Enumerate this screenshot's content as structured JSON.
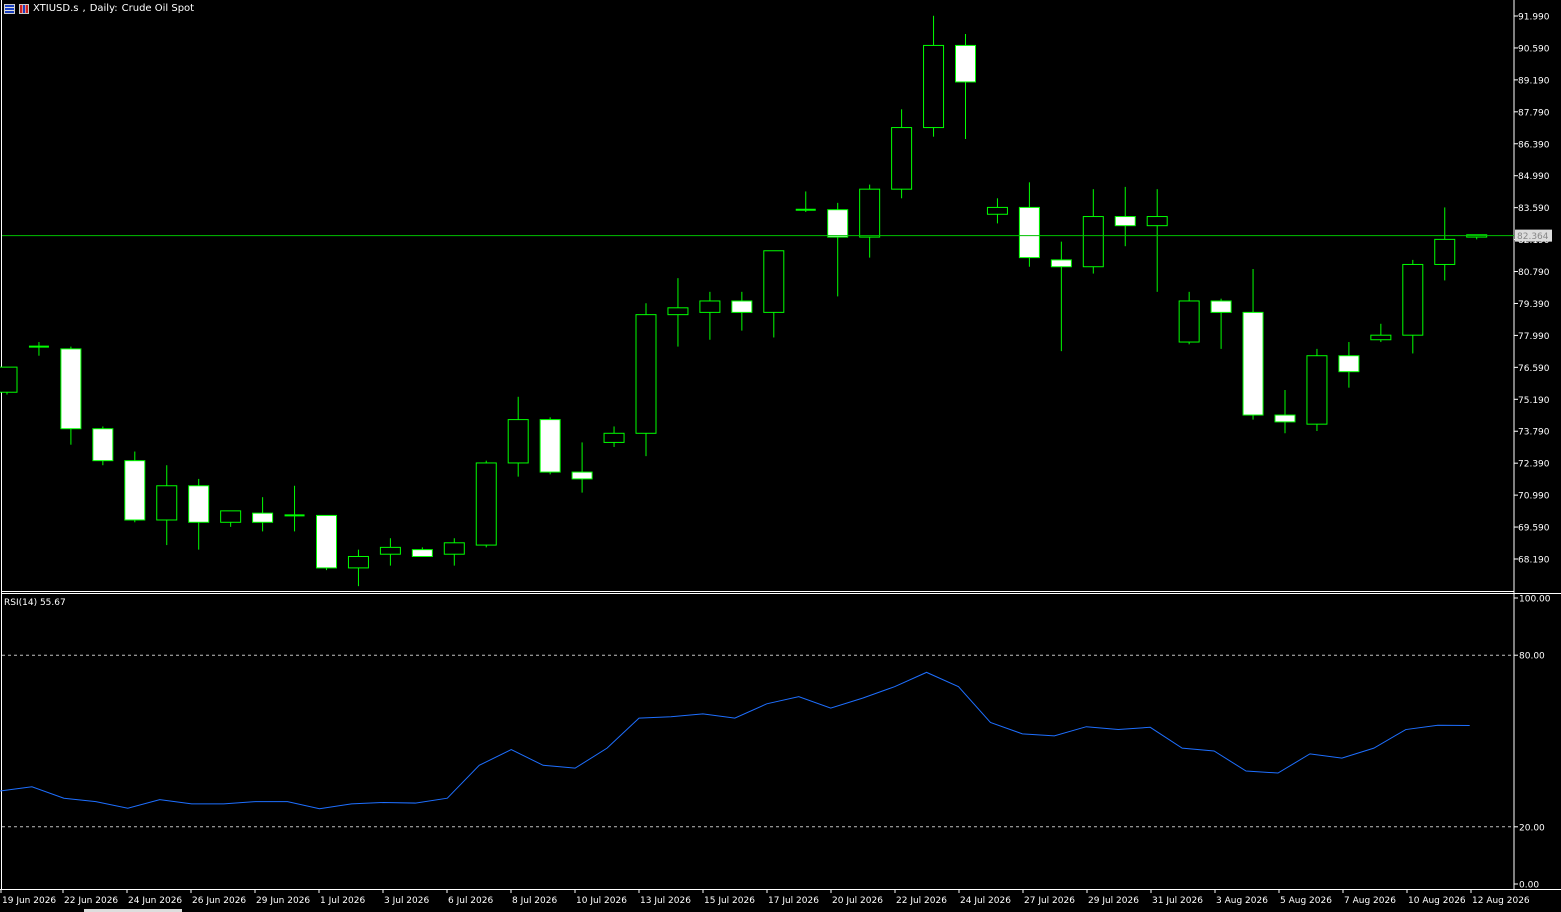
{
  "header": {
    "symbol": "XTIUSD.s",
    "timeframe": "Daily:",
    "description": "Crude Oil Spot",
    "icons": [
      "chart-type-icon",
      "flag-icon"
    ]
  },
  "colors": {
    "background": "#000000",
    "candle_outline": "#00ff00",
    "bear_body": "#ffffff",
    "bull_body": "#000000",
    "price_line": "#00c000",
    "rsi_line": "#1e6fff",
    "grid_axis": "#ffffff",
    "level_lines": "#c0c0c0"
  },
  "chart_data": [
    {
      "type": "candlestick",
      "title": "XTIUSD.s, Daily: Crude Oil Spot",
      "price_axis_ticks": [
        "91.990",
        "90.590",
        "89.190",
        "87.790",
        "86.390",
        "84.990",
        "83.590",
        "82.190",
        "80.790",
        "79.390",
        "77.990",
        "76.590",
        "75.190",
        "73.790",
        "72.390",
        "70.990",
        "69.590",
        "68.190"
      ],
      "current_price": "82.364",
      "ylim": [
        66.8,
        92.4
      ],
      "date_labels": [
        "19 Jun 2026",
        "22 Jun 2026",
        "24 Jun 2026",
        "26 Jun 2026",
        "29 Jun 2026",
        "1 Jul 2026",
        "3 Jul 2026",
        "6 Jul 2026",
        "8 Jul 2026",
        "10 Jul 2026",
        "13 Jul 2026",
        "15 Jul 2026",
        "17 Jul 2026",
        "20 Jul 2026",
        "22 Jul 2026",
        "24 Jul 2026",
        "27 Jul 2026",
        "29 Jul 2026",
        "31 Jul 2026",
        "3 Aug 2026",
        "5 Aug 2026",
        "7 Aug 2026",
        "10 Aug 2026",
        "12 Aug 2026"
      ],
      "ohlc": [
        [
          75.5,
          76.6,
          75.4,
          76.6
        ],
        [
          77.5,
          77.7,
          77.1,
          77.5
        ],
        [
          77.4,
          77.5,
          73.2,
          73.9
        ],
        [
          73.9,
          74.0,
          72.3,
          72.5
        ],
        [
          72.5,
          72.9,
          69.8,
          69.9
        ],
        [
          69.9,
          72.3,
          68.8,
          71.4
        ],
        [
          71.4,
          71.7,
          68.6,
          69.8
        ],
        [
          69.8,
          70.3,
          69.6,
          70.3
        ],
        [
          70.2,
          70.9,
          69.4,
          69.8
        ],
        [
          70.1,
          71.4,
          69.4,
          70.1
        ],
        [
          70.1,
          70.1,
          67.7,
          67.8
        ],
        [
          67.8,
          68.6,
          67.0,
          68.3
        ],
        [
          68.4,
          69.1,
          67.9,
          68.7
        ],
        [
          68.6,
          68.7,
          68.3,
          68.3
        ],
        [
          68.4,
          69.1,
          67.9,
          68.9
        ],
        [
          68.8,
          72.5,
          68.7,
          72.4
        ],
        [
          72.4,
          75.3,
          71.8,
          74.3
        ],
        [
          74.3,
          74.4,
          71.9,
          72.0
        ],
        [
          72.0,
          73.3,
          71.1,
          71.7
        ],
        [
          73.3,
          74.0,
          73.1,
          73.7
        ],
        [
          73.7,
          79.4,
          72.7,
          78.9
        ],
        [
          78.9,
          80.5,
          77.5,
          79.2
        ],
        [
          79.0,
          79.9,
          77.8,
          79.5
        ],
        [
          79.5,
          79.9,
          78.2,
          79.0
        ],
        [
          79.0,
          81.6,
          77.9,
          81.7
        ],
        [
          83.5,
          84.3,
          83.4,
          83.5
        ],
        [
          83.5,
          83.8,
          79.7,
          82.3
        ],
        [
          82.3,
          84.6,
          81.4,
          84.4
        ],
        [
          84.4,
          87.9,
          84.0,
          87.1
        ],
        [
          87.1,
          92.0,
          86.7,
          90.7
        ],
        [
          90.7,
          91.2,
          86.6,
          89.1
        ],
        [
          83.3,
          84.0,
          82.9,
          83.6
        ],
        [
          83.6,
          84.7,
          81.0,
          81.4
        ],
        [
          81.3,
          82.1,
          77.3,
          81.0
        ],
        [
          81.0,
          84.4,
          80.7,
          83.2
        ],
        [
          83.2,
          84.5,
          81.9,
          82.8
        ],
        [
          82.8,
          84.4,
          79.9,
          83.2
        ],
        [
          77.7,
          79.9,
          77.6,
          79.5
        ],
        [
          79.5,
          79.6,
          77.4,
          79.0
        ],
        [
          79.0,
          80.9,
          74.3,
          74.5
        ],
        [
          74.5,
          75.6,
          73.7,
          74.2
        ],
        [
          74.1,
          77.4,
          73.8,
          77.1
        ],
        [
          77.1,
          77.7,
          75.7,
          76.4
        ],
        [
          77.8,
          78.5,
          77.7,
          78.0
        ],
        [
          78.0,
          81.3,
          77.2,
          81.1
        ],
        [
          81.1,
          83.6,
          80.4,
          82.2
        ],
        [
          82.3,
          82.4,
          82.2,
          82.4
        ]
      ]
    },
    {
      "type": "line",
      "title": "RSI(14) 55.67",
      "indicator": "RSI(14)",
      "last_value": "55.67",
      "ylim": [
        0,
        100
      ],
      "axis_ticks": [
        "100.00",
        "80.00",
        "20.00",
        "0.00"
      ],
      "levels": [
        80,
        20
      ],
      "values": [
        32.5,
        34.0,
        30.0,
        28.8,
        26.5,
        29.5,
        28.0,
        28.0,
        28.8,
        28.8,
        26.3,
        28.0,
        28.5,
        28.3,
        30.0,
        41.5,
        47.0,
        41.5,
        40.5,
        47.5,
        58.0,
        58.5,
        59.5,
        58.0,
        63.0,
        65.5,
        61.5,
        65.0,
        69.0,
        74.0,
        69.0,
        56.5,
        52.5,
        51.8,
        55.0,
        54.0,
        54.8,
        47.5,
        46.5,
        39.5,
        38.8,
        45.5,
        44.0,
        47.5,
        54.0,
        55.5,
        55.4
      ]
    }
  ]
}
